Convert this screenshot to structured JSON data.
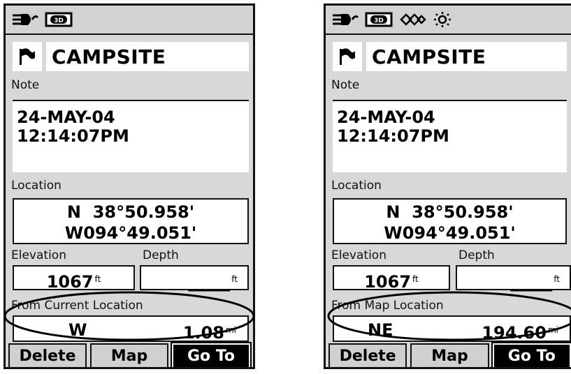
{
  "left": {
    "status_icons": [
      "power-plug-icon",
      "3d-fix-icon"
    ],
    "waypoint_name": "CAMPSITE",
    "note_label": "Note",
    "note_line1": "24-MAY-04",
    "note_line2": "12:14:07PM",
    "location_label": "Location",
    "lat": "N  38°50.958'",
    "lon": "W094°49.051'",
    "elevation_label": "Elevation",
    "depth_label": "Depth",
    "elevation_value": "1067",
    "elevation_unit": "ft",
    "depth_value": "_____",
    "depth_unit": "ft",
    "from_label": "From Current Location",
    "from_direction": "W",
    "from_distance": "1.08",
    "from_unit": "mi",
    "buttons": {
      "delete": "Delete",
      "map": "Map",
      "goto": "Go To"
    }
  },
  "right": {
    "status_icons": [
      "power-plug-icon",
      "3d-fix-icon",
      "waas-icon",
      "backlight-icon"
    ],
    "waypoint_name": "CAMPSITE",
    "note_label": "Note",
    "note_line1": "24-MAY-04",
    "note_line2": "12:14:07PM",
    "location_label": "Location",
    "lat": "N  38°50.958'",
    "lon": "W094°49.051'",
    "elevation_label": "Elevation",
    "depth_label": "Depth",
    "elevation_value": "1067",
    "elevation_unit": "ft",
    "depth_value": "_____",
    "depth_unit": "ft",
    "from_label": "From Map Location",
    "from_direction": "NE",
    "from_distance": "194.60",
    "from_unit": "mi",
    "buttons": {
      "delete": "Delete",
      "map": "Map",
      "goto": "Go To"
    }
  }
}
